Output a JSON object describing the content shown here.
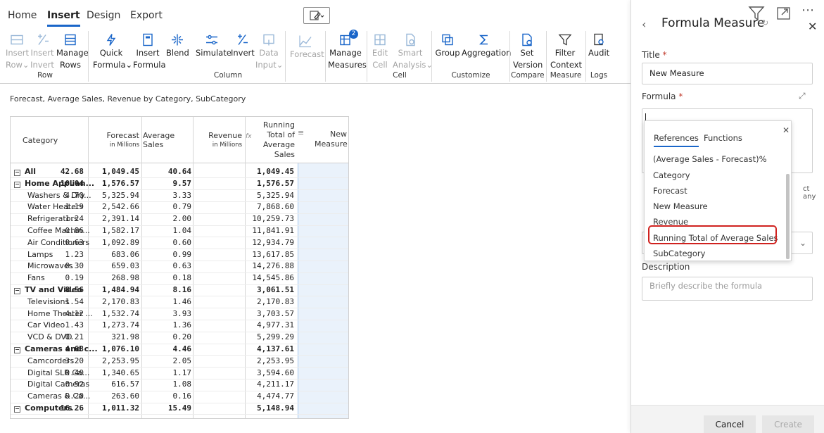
{
  "menu": {
    "tabs": [
      "Home",
      "Insert",
      "Design",
      "Export"
    ],
    "active_tab": "Insert"
  },
  "ribbon": {
    "insert_row": "Insert",
    "insert_row2": "Row",
    "insert_column": "Insert",
    "insert_column2": "Invert",
    "manage_rows": "Manage",
    "manage_rows2": "Rows",
    "quick_formula": "Quick",
    "quick_formula2": "Formula",
    "insert_formula": "Insert",
    "insert_formula2": "Formula",
    "blend": "Blend",
    "simulate": "Simulate",
    "invert": "Invert",
    "data_input": "Data",
    "data_input2": "Input",
    "forecast": "Forecast",
    "manage_measures": "Manage",
    "manage_measures2": "Measures",
    "measures_badge": "2",
    "edit_cell": "Edit",
    "edit_cell2": "Cell",
    "smart_analysis": "Smart",
    "smart_analysis2": "Analysis",
    "group": "Group",
    "aggregation": "Aggregation",
    "set_version": "Set",
    "set_version2": "Version",
    "filter_context": "Filter",
    "filter_context2": "Context",
    "audit": "Audit",
    "groups": [
      "Row",
      "Column",
      "Cell",
      "Customize",
      "Compare",
      "Measure",
      "Logs"
    ]
  },
  "table": {
    "subtitle": "Forecast, Average Sales, Revenue by Category, SubCategory",
    "headers": {
      "category": "Category",
      "forecast": "Forecast",
      "forecast_unit": "in Millions",
      "avg_sales": "Average Sales",
      "revenue": "Revenue",
      "revenue_unit": "in Millions",
      "running_total": "Running Total of Average Sales",
      "new_measure": "New Measure",
      "fx": "fx"
    },
    "rows": [
      {
        "cat": "All",
        "f": "42.68",
        "a": "1,049.45",
        "r": "40.64",
        "t": "1,049.45",
        "level": 0
      },
      {
        "cat": "Home Applian...",
        "f": "10.04",
        "a": "1,576.57",
        "r": "9.57",
        "t": "1,576.57",
        "level": 0
      },
      {
        "cat": "Washers & Dry...",
        "f": "4.70",
        "a": "5,325.94",
        "r": "3.33",
        "t": "5,325.94",
        "level": 1
      },
      {
        "cat": "Water Heaters",
        "f": "1.19",
        "a": "2,542.66",
        "r": "0.79",
        "t": "7,868.60",
        "level": 1
      },
      {
        "cat": "Refrigerators",
        "f": "1.24",
        "a": "2,391.14",
        "r": "2.00",
        "t": "10,259.73",
        "level": 1
      },
      {
        "cat": "Coffee Machin...",
        "f": "0.86",
        "a": "1,582.17",
        "r": "1.04",
        "t": "11,841.91",
        "level": 1
      },
      {
        "cat": "Air Conditioners",
        "f": "0.63",
        "a": "1,092.89",
        "r": "0.60",
        "t": "12,934.79",
        "level": 1
      },
      {
        "cat": "Lamps",
        "f": "1.23",
        "a": "683.06",
        "r": "0.99",
        "t": "13,617.85",
        "level": 1
      },
      {
        "cat": "Microwaves",
        "f": "0.30",
        "a": "659.03",
        "r": "0.63",
        "t": "14,276.88",
        "level": 1
      },
      {
        "cat": "Fans",
        "f": "0.19",
        "a": "268.98",
        "r": "0.18",
        "t": "14,545.86",
        "level": 1
      },
      {
        "cat": "TV and Video",
        "f": "8.56",
        "a": "1,484.94",
        "r": "8.16",
        "t": "3,061.51",
        "level": 0
      },
      {
        "cat": "Televisions",
        "f": "1.54",
        "a": "2,170.83",
        "r": "1.46",
        "t": "2,170.83",
        "level": 1
      },
      {
        "cat": "Home Theater ...",
        "f": "4.12",
        "a": "1,532.74",
        "r": "3.93",
        "t": "3,703.57",
        "level": 1
      },
      {
        "cat": "Car Video",
        "f": "1.43",
        "a": "1,273.74",
        "r": "1.36",
        "t": "4,977.31",
        "level": 1
      },
      {
        "cat": "VCD & DVD",
        "f": "0.21",
        "a": "321.98",
        "r": "0.20",
        "t": "5,299.29",
        "level": 1
      },
      {
        "cat": "Cameras and c...",
        "f": "4.68",
        "a": "1,076.10",
        "r": "4.46",
        "t": "4,137.61",
        "level": 0
      },
      {
        "cat": "Camcorders",
        "f": "3.20",
        "a": "2,253.95",
        "r": "2.05",
        "t": "2,253.95",
        "level": 1
      },
      {
        "cat": "Digital SLR Ca...",
        "f": "0.40",
        "a": "1,340.65",
        "r": "1.17",
        "t": "3,594.60",
        "level": 1
      },
      {
        "cat": "Digital Cameras",
        "f": "0.92",
        "a": "616.57",
        "r": "1.08",
        "t": "4,211.17",
        "level": 1
      },
      {
        "cat": "Cameras & Ca...",
        "f": "0.20",
        "a": "263.60",
        "r": "0.16",
        "t": "4,474.77",
        "level": 1
      },
      {
        "cat": "Computers",
        "f": "16.26",
        "a": "1,011.32",
        "r": "15.49",
        "t": "5,148.94",
        "level": 0
      }
    ]
  },
  "panel": {
    "title": "Formula Measure",
    "title_label": "Title",
    "title_value": "New Measure",
    "formula_label": "Formula",
    "hint_fragment": "ct any",
    "description_label": "Description",
    "description_placeholder": "Briefly describe the formula",
    "cancel": "Cancel",
    "create": "Create",
    "dropdown": {
      "tabs": [
        "References",
        "Functions"
      ],
      "items": [
        "(Average Sales - Forecast)%",
        "Category",
        "Forecast",
        "New Measure",
        "Revenue",
        "Running Total of Average Sales",
        "SubCategory"
      ]
    }
  },
  "colors": {
    "accent": "#1a66c9",
    "highlight_border": "#d0221f",
    "selected_column": "#eaf2fb"
  }
}
